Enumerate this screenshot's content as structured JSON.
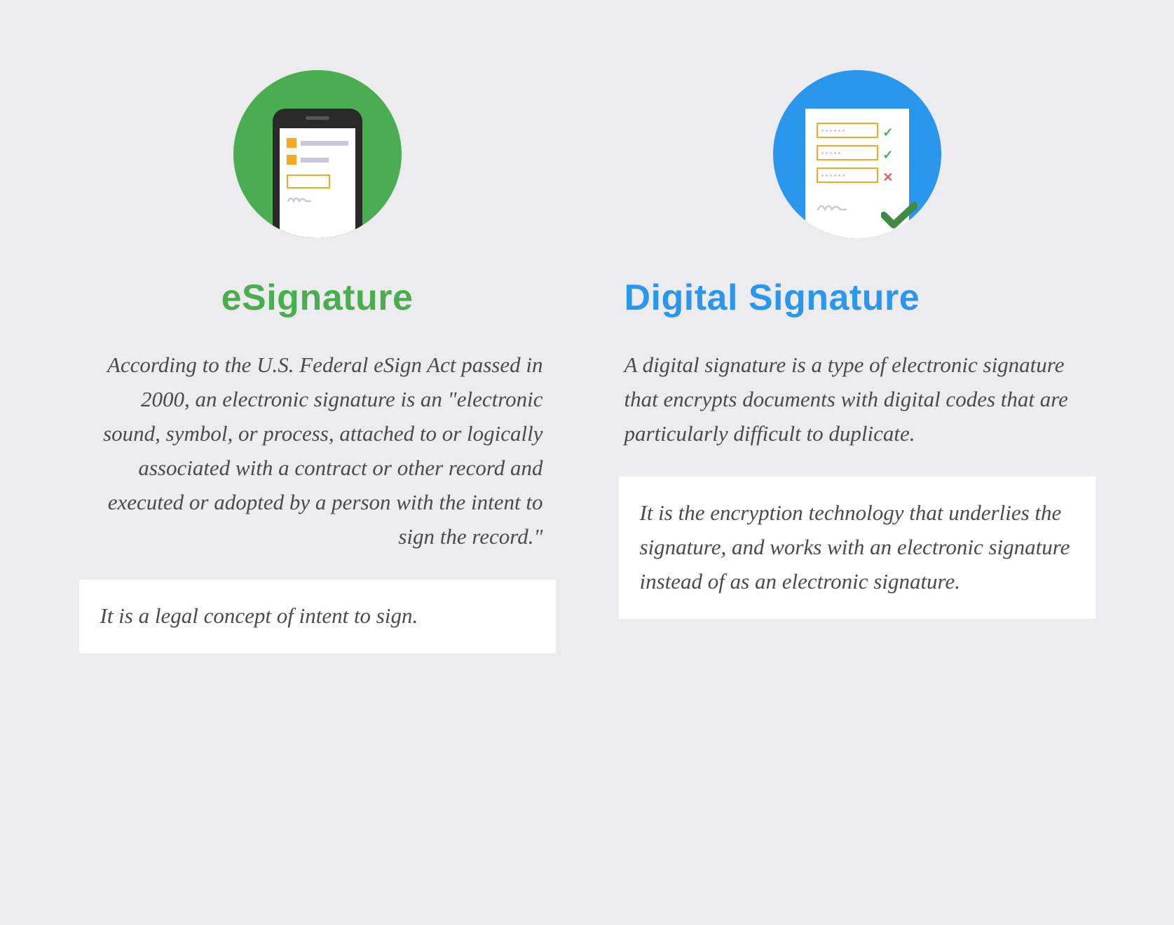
{
  "left": {
    "title": "eSignature",
    "body": "According to the U.S. Federal eSign Act passed in 2000, an electronic signature is an \"electronic sound, symbol, or process, attached to or logically associated with a contract or other record and executed or adopted by a person with the intent to sign the record.\"",
    "highlight": "It is a legal concept of intent to sign."
  },
  "right": {
    "title": "Digital Signature",
    "body": "A digital signature is a type of electronic signature that encrypts documents with digital codes that are particularly difficult to duplicate.",
    "highlight": "It is the encryption technology that underlies the signature, and works with an electronic signature instead of as an electronic signature."
  },
  "colors": {
    "green": "#4aad52",
    "blue": "#2a97ec",
    "orange": "#f5a623"
  }
}
